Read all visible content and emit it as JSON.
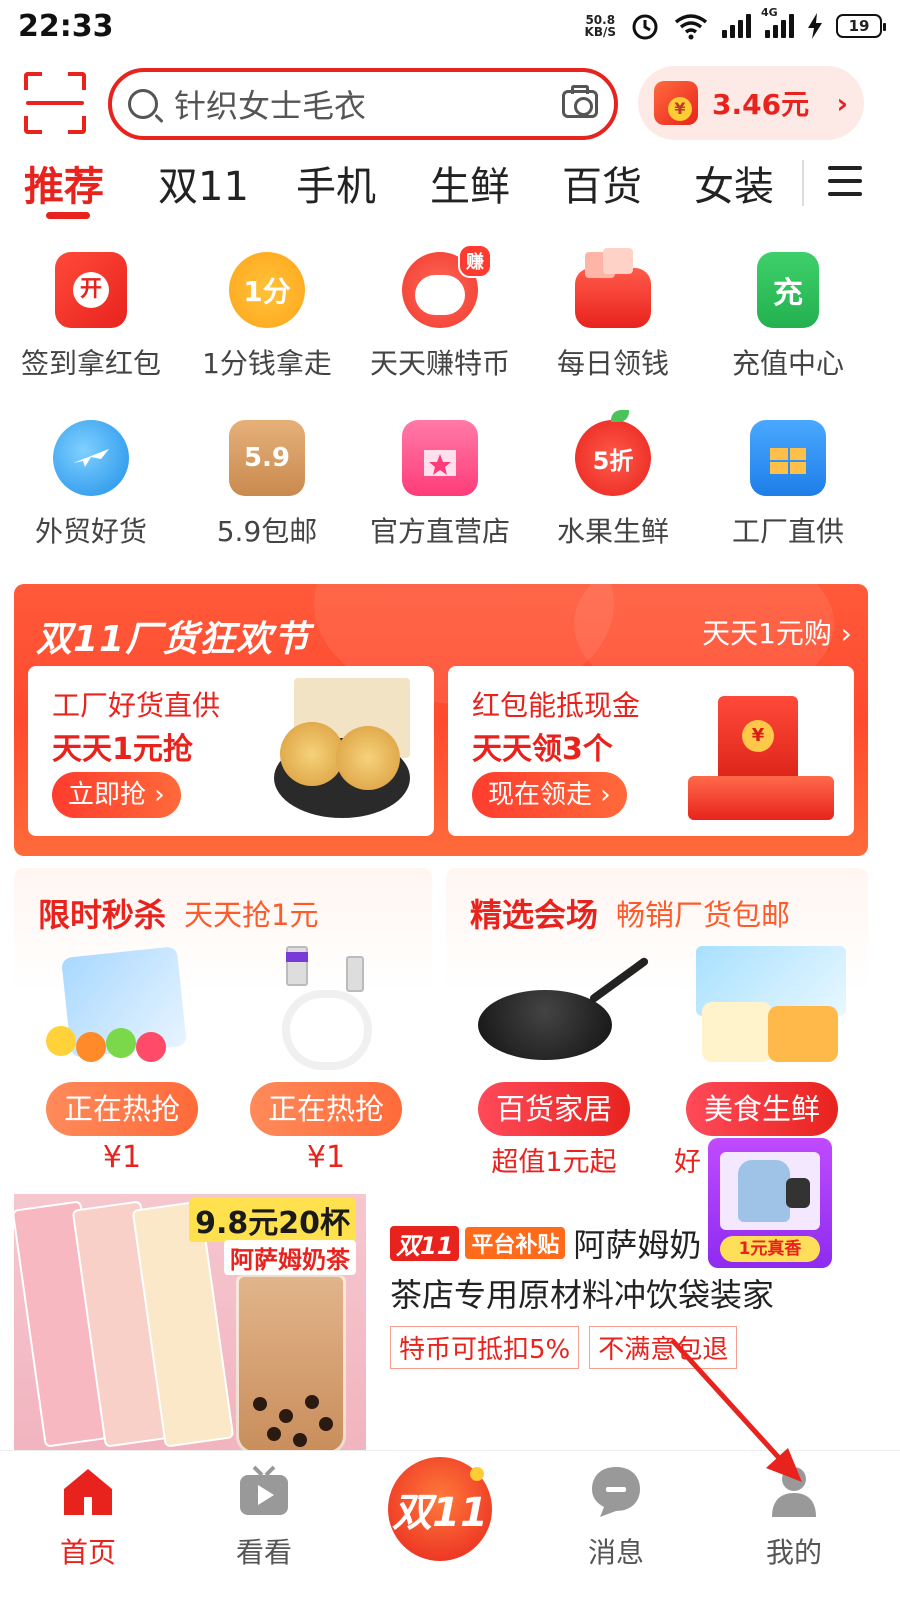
{
  "status_bar": {
    "time": "22:33",
    "net_speed_value": "50.8",
    "net_speed_unit": "KB/S",
    "network_type": "4G",
    "battery": "19"
  },
  "search": {
    "placeholder": "针织女士毛衣",
    "coin_amount": "3.46元"
  },
  "tabs": [
    "推荐",
    "双11",
    "手机",
    "生鲜",
    "百货",
    "女装"
  ],
  "quick_icons": [
    {
      "label": "签到拿红包",
      "icon": "calendar-redpacket-icon",
      "glyph": "开"
    },
    {
      "label": "1分钱拿走",
      "icon": "one-cent-coin-icon",
      "glyph": "1分"
    },
    {
      "label": "天天赚特币",
      "icon": "lucky-cat-icon",
      "glyph": "赚"
    },
    {
      "label": "每日领钱",
      "icon": "wallet-icon",
      "glyph": ""
    },
    {
      "label": "充值中心",
      "icon": "phone-recharge-icon",
      "glyph": "充"
    },
    {
      "label": "外贸好货",
      "icon": "globe-plane-icon",
      "glyph": ""
    },
    {
      "label": "5.9包邮",
      "icon": "parcel-box-icon",
      "glyph": "5.9"
    },
    {
      "label": "官方直营店",
      "icon": "storefront-icon",
      "glyph": ""
    },
    {
      "label": "水果生鲜",
      "icon": "apple-icon",
      "glyph": "5折"
    },
    {
      "label": "工厂直供",
      "icon": "factory-icon",
      "glyph": ""
    }
  ],
  "banner": {
    "title": "双11厂货狂欢节",
    "more": "天天1元购 ›",
    "card_left": {
      "line1": "工厂好货直供",
      "line2": "天天1元抢",
      "button": "立即抢 ›"
    },
    "card_right": {
      "line1": "红包能抵现金",
      "line2": "天天领3个",
      "button": "现在领走 ›"
    }
  },
  "flash_sale": {
    "title": "限时秒杀",
    "subtitle": "天天抢1元",
    "items": [
      {
        "pill": "正在热抢",
        "price": "¥1"
      },
      {
        "pill": "正在热抢",
        "price": "¥1"
      }
    ]
  },
  "selected_venue": {
    "title": "精选会场",
    "subtitle": "畅销厂货包邮",
    "items": [
      {
        "pill": "百货家居",
        "sub": "超值1元起"
      },
      {
        "pill": "美食生鲜",
        "sub": "好"
      }
    ]
  },
  "listing": {
    "promo_price": "9.8元20杯",
    "promo_name": "阿萨姆奶茶",
    "tag_d11": "双11",
    "tag_subsidy": "平台补贴",
    "title_line1": "阿萨姆奶",
    "title_line2": "茶店专用原材料冲饮袋装家",
    "tags": [
      "特币可抵扣5%",
      "不满意包退"
    ]
  },
  "float_promo": {
    "label": "1元真香"
  },
  "bottom_nav": {
    "home": "首页",
    "watch": "看看",
    "center": "双11",
    "messages": "消息",
    "mine": "我的"
  },
  "colors": {
    "accent": "#e8231e",
    "orange": "#ff6b1a"
  }
}
